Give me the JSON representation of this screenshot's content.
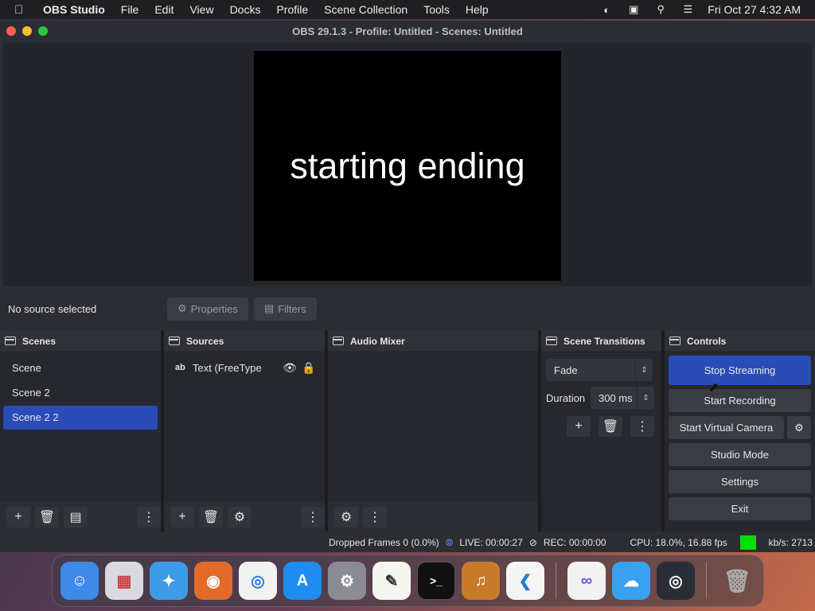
{
  "menubar": {
    "app_name": "OBS Studio",
    "menus": [
      "File",
      "Edit",
      "View",
      "Docks",
      "Profile",
      "Scene Collection",
      "Tools",
      "Help"
    ],
    "clock": "Fri Oct 27  4:32 AM"
  },
  "window": {
    "title": "OBS 29.1.3 - Profile: Untitled - Scenes: Untitled"
  },
  "preview": {
    "text": "starting ending"
  },
  "source_bar": {
    "status": "No source selected",
    "properties_label": "Properties",
    "filters_label": "Filters"
  },
  "scenes": {
    "title": "Scenes",
    "items": [
      "Scene",
      "Scene 2",
      "Scene 2 2"
    ],
    "selected": "Scene 2 2"
  },
  "sources": {
    "title": "Sources",
    "items": [
      {
        "type": "ab",
        "name": "Text (FreeType"
      }
    ]
  },
  "audio_mixer": {
    "title": "Audio Mixer"
  },
  "transitions": {
    "title": "Scene Transitions",
    "selected": "Fade",
    "duration_label": "Duration",
    "duration_value": "300 ms"
  },
  "controls": {
    "title": "Controls",
    "stop_streaming": "Stop Streaming",
    "start_recording": "Start Recording",
    "start_virtual_camera": "Start Virtual Camera",
    "studio_mode": "Studio Mode",
    "settings": "Settings",
    "exit": "Exit"
  },
  "status": {
    "dropped_frames": "Dropped Frames 0 (0.0%)",
    "live": "LIVE: 00:00:27",
    "rec": "REC: 00:00:00",
    "cpu": "CPU: 18.0%, 16.88 fps",
    "kbs": "kb/s: 2713"
  },
  "colors": {
    "accent": "#2a4bb8",
    "status_ok": "#00e000"
  }
}
